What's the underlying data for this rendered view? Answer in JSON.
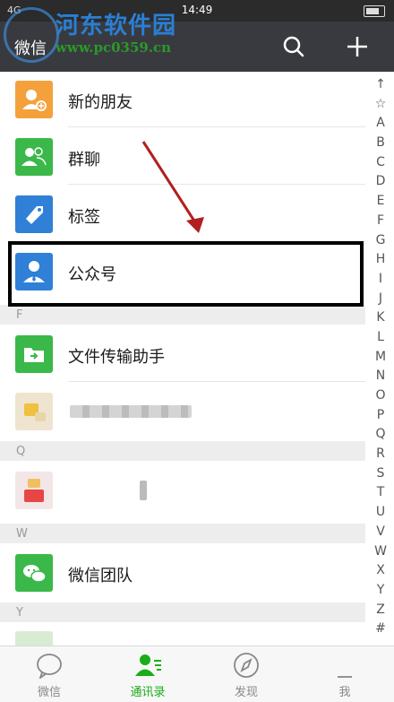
{
  "status_bar": {
    "signal": "4G",
    "time": "14:49"
  },
  "header": {
    "title": "微信"
  },
  "watermark": {
    "site_name": "河东软件园",
    "site_url": "www.pc0359.cn"
  },
  "contacts": {
    "new_friends": "新的朋友",
    "group_chats": "群聊",
    "tags": "标签",
    "official_accounts": "公众号",
    "section_f": "F",
    "file_transfer": "文件传输助手",
    "section_q": "Q",
    "section_w": "W",
    "wechat_team": "微信团队",
    "section_y": "Y"
  },
  "index_letters": [
    "↑",
    "☆",
    "A",
    "B",
    "C",
    "D",
    "E",
    "F",
    "G",
    "H",
    "I",
    "J",
    "K",
    "L",
    "M",
    "N",
    "O",
    "P",
    "Q",
    "R",
    "S",
    "T",
    "U",
    "V",
    "W",
    "X",
    "Y",
    "Z",
    "#"
  ],
  "tabs": [
    {
      "label": "微信",
      "active": false
    },
    {
      "label": "通讯录",
      "active": true
    },
    {
      "label": "发现",
      "active": false
    },
    {
      "label": "我",
      "active": false
    }
  ],
  "colors": {
    "accent": "#1aad19",
    "topbar": "#393a3f",
    "orange": "#f4a13c",
    "green": "#3bb84a",
    "blue": "#2f80d6"
  }
}
